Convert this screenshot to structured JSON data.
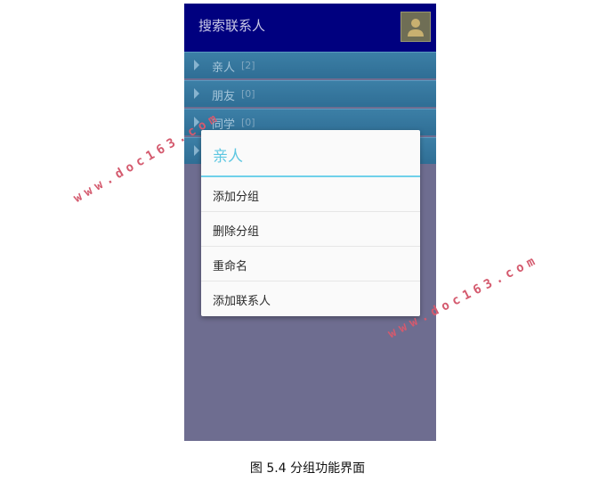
{
  "app": {
    "header": {
      "title": "搜索联系人",
      "avatar_icon": "user-avatar-icon"
    },
    "groups": [
      {
        "name": "亲人",
        "count": "[2]"
      },
      {
        "name": "朋友",
        "count": "[0]"
      },
      {
        "name": "同学",
        "count": "[0]"
      },
      {
        "name": "",
        "count": ""
      }
    ],
    "dialog": {
      "title": "亲人",
      "items": [
        "添加分组",
        "删除分组",
        "重命名",
        "添加联系人"
      ]
    }
  },
  "caption": "图 5.4 分组功能界面",
  "watermark": "www.doc163.com",
  "colors": {
    "header": "#00007f",
    "group_row": "#3c7fa6",
    "dialog_accent": "#5ec7e1",
    "watermark": "#d45a6e"
  }
}
